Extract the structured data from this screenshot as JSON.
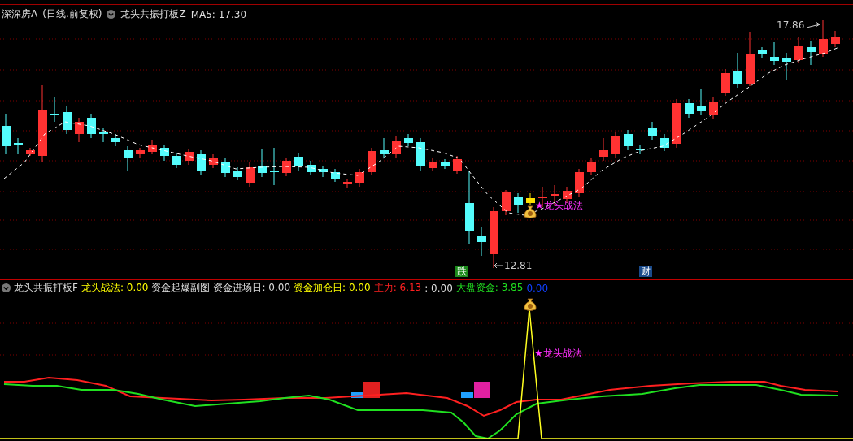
{
  "main_panel": {
    "header": {
      "symbol": "深深房A",
      "period": "(日线.前复权)",
      "indicator": "龙头共振打板Z",
      "ma_label": "MA5: 17.30"
    },
    "labels": [
      {
        "kind": "price",
        "text": "17.86"
      },
      {
        "kind": "price",
        "text": "12.81"
      },
      {
        "kind": "signal",
        "text": "★龙头战法"
      },
      {
        "kind": "badge",
        "text": "跌",
        "color": "#1a8a1a"
      },
      {
        "kind": "badge",
        "text": "财",
        "color": "#1a4a8a"
      }
    ]
  },
  "sub_panel": {
    "title": "龙头共振打板F",
    "items": [
      {
        "label": "龙头战法:",
        "value": "0.00",
        "color": "#ffff00"
      },
      {
        "label": "资金起爆副图"
      },
      {
        "label": "资金进场日:",
        "value": "0.00"
      },
      {
        "label": "资金加仓日:",
        "value": "0.00",
        "color": "#ffff00"
      },
      {
        "label": "主力:",
        "value": "6.13",
        "color": "#ff2020"
      },
      {
        "label": ":",
        "value": "0.00"
      },
      {
        "label": "大盘资金:",
        "value": "3.85",
        "color": "#20dd20"
      },
      {
        "value": "0.00",
        "color": "#1040ff"
      }
    ],
    "signal": "★龙头战法"
  }
}
